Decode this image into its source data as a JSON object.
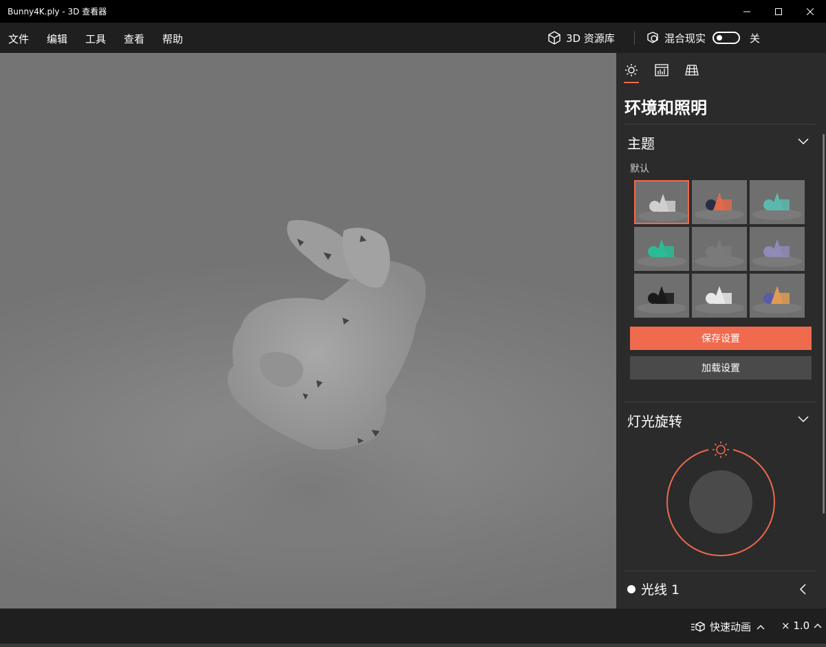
{
  "window": {
    "title": "Bunny4K.ply - 3D 查看器"
  },
  "menu": {
    "items": [
      "文件",
      "编辑",
      "工具",
      "查看",
      "帮助"
    ],
    "library_label": "3D 资源库",
    "mixed_reality_label": "混合现实",
    "toggle_state": "关"
  },
  "panel": {
    "title": "环境和照明",
    "theme_section": {
      "heading": "主题",
      "subheading": "默认",
      "selected_index": 0,
      "themes": [
        {
          "shape": "#cfcfcf",
          "bg": "#6f6f6f"
        },
        {
          "shape": "#e06a4a",
          "bg": "#6f6f6f",
          "dark": "#2a2e44"
        },
        {
          "shape": "#5bb8ad",
          "bg": "#6f6f6f"
        },
        {
          "shape": "#2bbc95",
          "bg": "#6f6f6f"
        },
        {
          "shape": "#7a7a7a",
          "bg": "#6f6f6f"
        },
        {
          "shape": "#8f8ab8",
          "bg": "#6f6f6f"
        },
        {
          "shape": "#1a1a1a",
          "bg": "#6f6f6f"
        },
        {
          "shape": "#e8e8e8",
          "bg": "#6f6f6f"
        },
        {
          "shape": "#e09a54",
          "bg": "#6f6f6f",
          "dark": "#5a5aa8"
        }
      ]
    },
    "save_label": "保存设置",
    "load_label": "加载设置",
    "light_section": {
      "heading": "灯光旋转"
    },
    "light_item": "光线 1"
  },
  "bottom": {
    "animation_label": "快速动画",
    "speed_label": "× 1.0"
  },
  "colors": {
    "accent": "#f06a4e",
    "panel_bg": "#2b2b2b",
    "bar_bg": "#1f1f1f"
  }
}
